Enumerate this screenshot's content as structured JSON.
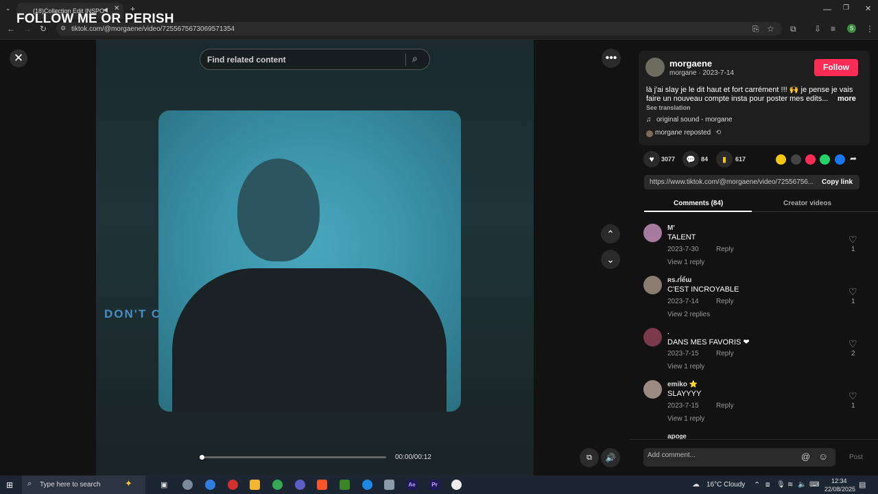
{
  "browser": {
    "tab_title": "(18)Collection Edit INSPO",
    "overlay_title": "FOLLOW ME OR PERISH",
    "url": "tiktok.com/@morgaene/video/7255675673069571354"
  },
  "video": {
    "search_placeholder": "Find related content",
    "overlay_text": "DON'T CHA",
    "time": "00:00/00:12",
    "progress": 0.0
  },
  "author": {
    "username": "morgaene",
    "display": "morgane · 2023-7-14",
    "follow_label": "Follow",
    "caption_line1": "là j'ai slay je le dit haut et fort carrément !!! 🙌 je pense je vais",
    "caption_line2": "faire un nouveau compte insta pour poster mes edits...",
    "more_label": "more",
    "see_translation": "See translation",
    "sound": "original sound - morgane",
    "reposted": "morgane reposted"
  },
  "stats": {
    "likes": "3077",
    "comments": "84",
    "saves": "617"
  },
  "share": {
    "link": "https://www.tiktok.com/@morgaene/video/72556756...",
    "copy_label": "Copy link",
    "colors": [
      "#f2c811",
      "#444444",
      "#fe2c55",
      "#25d366",
      "#1877f2"
    ]
  },
  "tabs": {
    "comments": "Comments (84)",
    "creator": "Creator videos"
  },
  "comments": [
    {
      "user": "M'",
      "text": "TALENT",
      "date": "2023-7-30",
      "reply": "Reply",
      "view": "View 1 reply",
      "likes": "1"
    },
    {
      "user": "ʀs.ɾĺểɯ",
      "text": "C'EST INCROYABLE",
      "date": "2023-7-14",
      "reply": "Reply",
      "view": "View 2 replies",
      "likes": "1"
    },
    {
      "user": ".",
      "text": "DANS MES FAVORIS ❤",
      "date": "2023-7-15",
      "reply": "Reply",
      "view": "View 1 reply",
      "likes": "2"
    },
    {
      "user": "emiko ⭐",
      "text": "SLAYYYY",
      "date": "2023-7-15",
      "reply": "Reply",
      "view": "View 1 reply",
      "likes": "1"
    }
  ],
  "next_comment_user": "apo𝔤e",
  "composer": {
    "placeholder": "Add comment...",
    "post_label": "Post"
  },
  "taskbar": {
    "search_placeholder": "Type here to search",
    "weather": "16°C  Cloudy",
    "time": "12:34",
    "date": "22/08/2025"
  }
}
